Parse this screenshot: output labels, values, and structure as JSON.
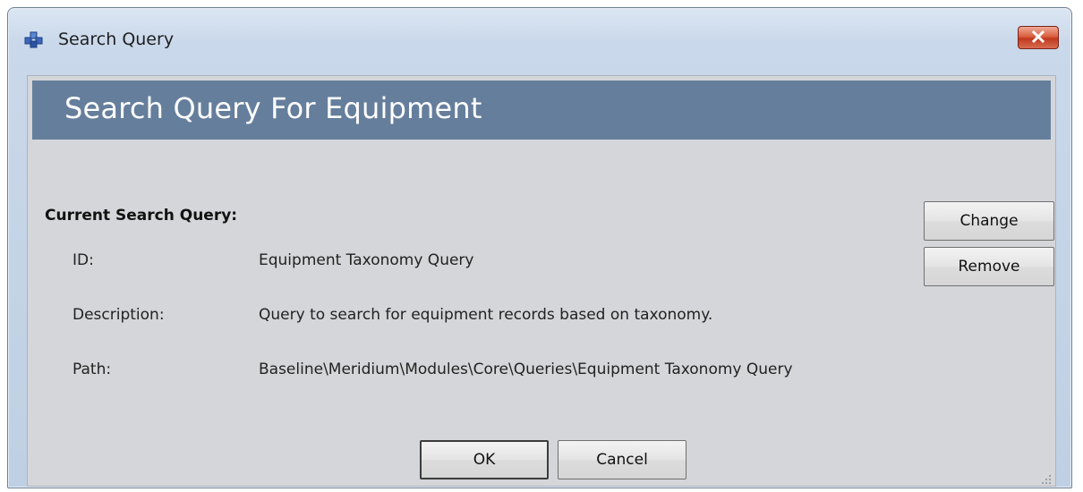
{
  "window": {
    "title": "Search Query"
  },
  "banner": {
    "title": "Search Query For Equipment"
  },
  "current_query": {
    "heading": "Current Search Query:",
    "fields": [
      {
        "label": "ID:",
        "value": "Equipment Taxonomy Query"
      },
      {
        "label": "Description:",
        "value": "Query to search for equipment records based on taxonomy."
      },
      {
        "label": "Path:",
        "value": "Baseline\\Meridium\\Modules\\Core\\Queries\\Equipment Taxonomy Query"
      }
    ]
  },
  "buttons": {
    "change": "Change",
    "remove": "Remove",
    "ok": "OK",
    "cancel": "Cancel"
  },
  "icons": {
    "app": "cubes-icon",
    "close": "close-icon"
  },
  "colors": {
    "banner": "#657e9c",
    "close": "#c0391d"
  }
}
